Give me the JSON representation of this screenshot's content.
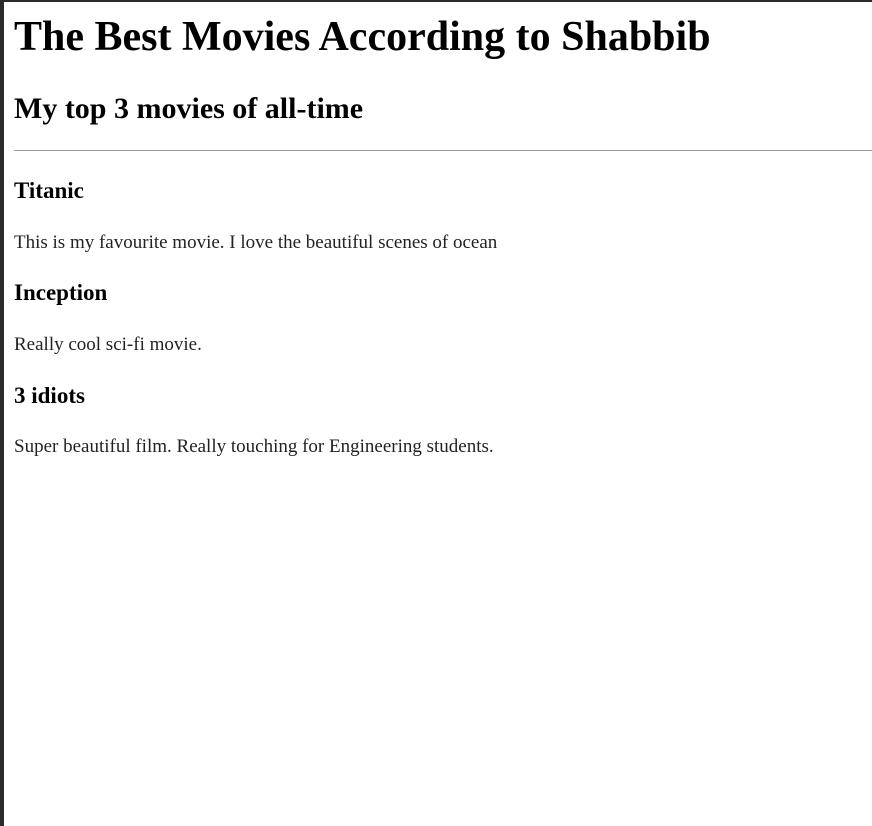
{
  "page": {
    "title": "The Best Movies According to Shabbib",
    "subtitle": "My top 3 movies of all-time"
  },
  "movies": [
    {
      "title": "Titanic",
      "description": "This is my favourite movie. I love the beautiful scenes of ocean"
    },
    {
      "title": "Inception",
      "description": "Really cool sci-fi movie."
    },
    {
      "title": "3 idiots",
      "description": "Super beautiful film. Really touching for Engineering students."
    }
  ]
}
